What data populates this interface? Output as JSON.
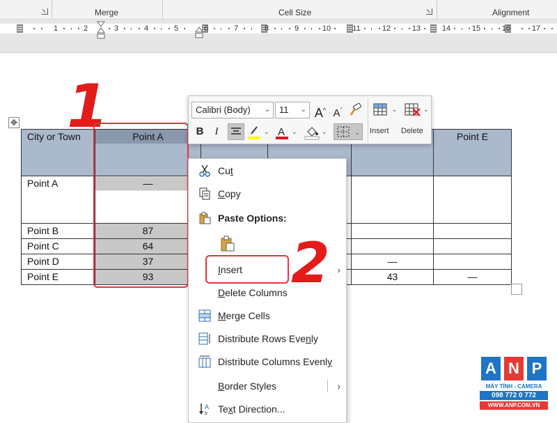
{
  "ribbon": {
    "groups": [
      "Merge",
      "Cell Size",
      "Alignment"
    ]
  },
  "ruler": {
    "numbers": [
      "1",
      "2",
      "3",
      "4",
      "5",
      "6",
      "7",
      "8",
      "9",
      "10",
      "11",
      "12",
      "13",
      "14",
      "15",
      "16",
      "17"
    ]
  },
  "table": {
    "header": [
      "City or Town",
      "Point A",
      "",
      "",
      "",
      "Point E"
    ],
    "rows": [
      [
        "Point A",
        "—",
        "",
        "",
        "",
        ""
      ],
      [
        "Point B",
        "87",
        "",
        "",
        "",
        ""
      ],
      [
        "Point C",
        "64",
        "",
        "",
        "",
        ""
      ],
      [
        "Point D",
        "37",
        "",
        "",
        "—",
        ""
      ],
      [
        "Point E",
        "93",
        "",
        "",
        "43",
        "—"
      ]
    ]
  },
  "annotations": {
    "step1": "1",
    "step2": "2"
  },
  "mini_toolbar": {
    "font_name": "Calibri (Body)",
    "font_size": "11",
    "insert_label": "Insert",
    "delete_label": "Delete",
    "highlight_color": "#ffff00",
    "font_color": "#e81123",
    "shading_color": "#ffffff"
  },
  "context_menu": {
    "items": [
      {
        "label": "Cut",
        "icon": "scissors-icon"
      },
      {
        "label": "Copy",
        "icon": "copy-icon"
      },
      {
        "label": "Paste Options:",
        "icon": "paste-icon"
      },
      {
        "label": "",
        "icon": "paste-keep-icon"
      },
      {
        "label": "Insert",
        "icon": "",
        "submenu": true
      },
      {
        "label": "Delete Columns",
        "icon": ""
      },
      {
        "label": "Merge Cells",
        "icon": "merge-cells-icon"
      },
      {
        "label": "Distribute Rows Evenly",
        "icon": "distribute-rows-icon"
      },
      {
        "label": "Distribute Columns Evenly",
        "icon": "distribute-columns-icon"
      },
      {
        "label": "Border Styles",
        "icon": "",
        "submenu": true
      },
      {
        "label": "Text Direction...",
        "icon": "text-direction-icon"
      }
    ]
  },
  "logo": {
    "letters": [
      "A",
      "N",
      "P"
    ],
    "line1": "MÁY TÍNH - CAMERA",
    "line2": "098 772 0 772",
    "line3": "WWW.ANP.COM.VN",
    "colors": [
      "#1e74c6",
      "#e53935",
      "#1e74c6"
    ]
  },
  "colors": {
    "accent_red": "#e5333b",
    "header_fill": "#abb9cc",
    "selected_fill": "#c8c8c8"
  }
}
